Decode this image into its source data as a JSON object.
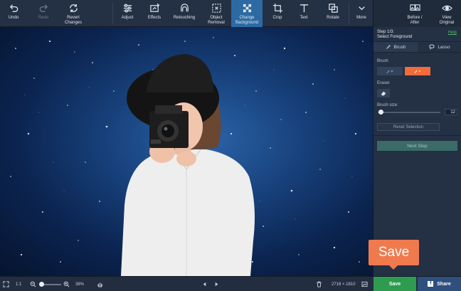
{
  "toolbar": {
    "undo": "Undo",
    "redo": "Redo",
    "revert": "Revert\nChanges",
    "adjust": "Adjust",
    "effects": "Effects",
    "retouching": "Retouching",
    "object_removal": "Object\nRemoval",
    "change_background": "Change\nBackground",
    "crop": "Crop",
    "text": "Text",
    "rotate": "Rotate",
    "more": "More",
    "before_after": "Before /\nAfter",
    "view_original": "View\nOriginal"
  },
  "panel": {
    "step": "Step 1/3:",
    "step_title": "Select Foreground",
    "help": "Help",
    "tab_brush": "Brush",
    "tab_lasso": "Lasso",
    "brush_label": "Brush",
    "eraser_label": "Eraser",
    "brush_size_label": "Brush size:",
    "brush_size_value": "12",
    "reset_selection": "Reset Selection",
    "next_step": "Next Step"
  },
  "bottombar": {
    "fit": "1:1",
    "zoom": "38%",
    "image_size": "2716 × 1810",
    "save": "Save",
    "share": "Share",
    "facebook_glyph": "f"
  },
  "callout": {
    "label": "Save"
  },
  "colors": {
    "accent_blue": "#2d6aa3",
    "save_green": "#2e9b4f",
    "callout_orange": "#f07a4e",
    "brush_orange": "#f26b3a"
  }
}
